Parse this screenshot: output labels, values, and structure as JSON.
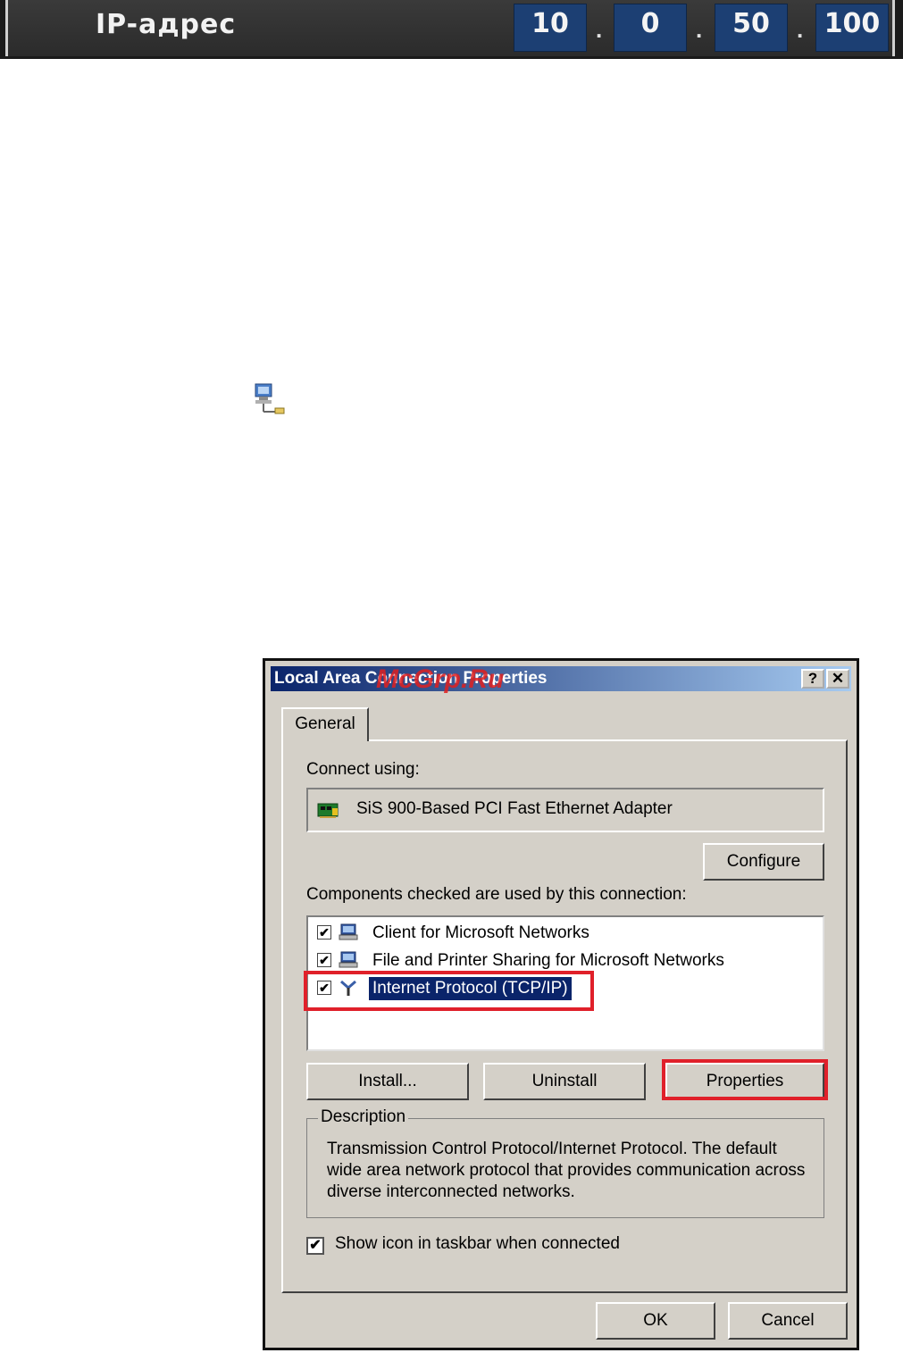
{
  "ip_bar": {
    "label": "IP-адрес",
    "octets": [
      "10",
      "0",
      "50",
      "100"
    ],
    "separator": "."
  },
  "dialog": {
    "title": "Local Area Connection Properties",
    "watermark": "McGrp.Ru",
    "help_button": "?",
    "close_button": "✕",
    "tab_general": "General",
    "connect_using_label": "Connect using:",
    "adapter_name": "SiS 900-Based PCI Fast Ethernet Adapter",
    "configure_button": "Configure",
    "components_label": "Components checked are used by this connection:",
    "components": [
      {
        "label": "Client for Microsoft Networks",
        "checked": true,
        "icon": "network-client-icon"
      },
      {
        "label": "File and Printer Sharing for Microsoft Networks",
        "checked": true,
        "icon": "file-printer-sharing-icon"
      },
      {
        "label": "Internet Protocol (TCP/IP)",
        "checked": true,
        "icon": "protocol-icon",
        "selected": true
      }
    ],
    "install_button": "Install...",
    "uninstall_button": "Uninstall",
    "properties_button": "Properties",
    "description_title": "Description",
    "description_text": "Transmission Control Protocol/Internet Protocol. The default wide area network protocol that provides communication across diverse interconnected networks.",
    "show_icon_label": "Show icon in taskbar when connected",
    "ok_button": "OK",
    "cancel_button": "Cancel",
    "checkmark": "✔",
    "highlight_color": "#e0202a",
    "selection_color": "#0a246a"
  }
}
